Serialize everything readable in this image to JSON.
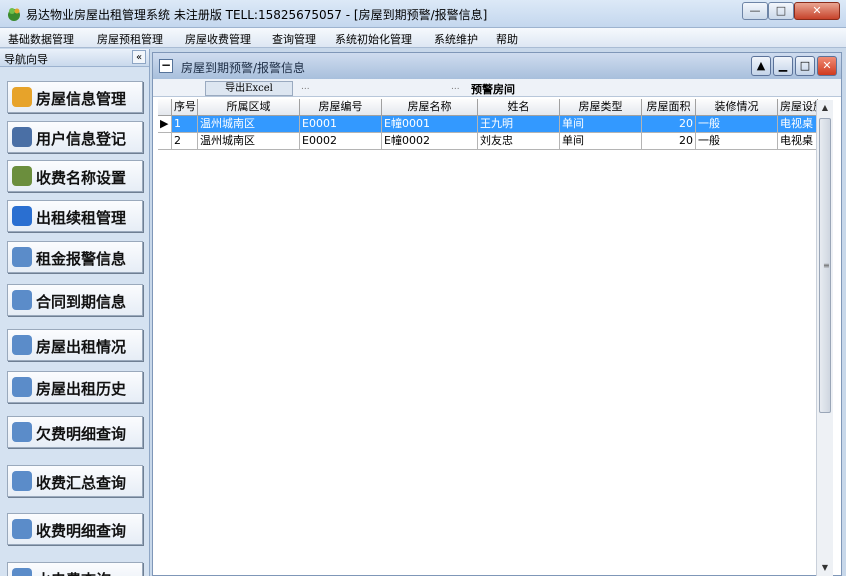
{
  "window": {
    "title": "易达物业房屋出租管理系统 未注册版 TELL:15825675057 - [房屋到期预警/报警信息]",
    "min_label": "—",
    "max_label": "□",
    "close_label": "✕"
  },
  "menu": [
    "基础数据管理",
    "房屋预租管理",
    "房屋收费管理",
    "查询管理",
    "系统初始化管理",
    "系统维护",
    "帮助"
  ],
  "nav": {
    "header": "导航向导",
    "collapse_label": "«",
    "items": [
      {
        "label": "房屋信息管理",
        "icon": "house-icon",
        "color": "#e7a32a"
      },
      {
        "label": "用户信息登记",
        "icon": "user-card-icon",
        "color": "#4a6fa5"
      },
      {
        "label": "收费名称设置",
        "icon": "money-bag-icon",
        "color": "#6b8e3d"
      },
      {
        "label": "出租续租管理",
        "icon": "renew-icon",
        "color": "#2a6fd1"
      },
      {
        "label": "租金报警信息",
        "icon": "magnifier-report-icon",
        "color": "#5b8cc9"
      },
      {
        "label": "合同到期信息",
        "icon": "magnifier-report-icon",
        "color": "#5b8cc9"
      },
      {
        "label": "房屋出租情况",
        "icon": "magnifier-report-icon",
        "color": "#5b8cc9"
      },
      {
        "label": "房屋出租历史",
        "icon": "magnifier-report-icon",
        "color": "#5b8cc9"
      },
      {
        "label": "欠费明细查询",
        "icon": "magnifier-report-icon",
        "color": "#5b8cc9"
      },
      {
        "label": "收费汇总查询",
        "icon": "magnifier-report-icon",
        "color": "#5b8cc9"
      },
      {
        "label": "收费明细查询",
        "icon": "magnifier-report-icon",
        "color": "#5b8cc9"
      },
      {
        "label": "水电费查询",
        "icon": "magnifier-report-icon",
        "color": "#5b8cc9"
      }
    ]
  },
  "panel": {
    "title": "房屋到期预警/报警信息",
    "collapse_label": "−",
    "btn_up": "▲",
    "btn_min": "▁",
    "btn_max": "□",
    "btn_close": "✕"
  },
  "toolbar": {
    "export_label": "导出Excel",
    "dots": "...",
    "caption": "预警房间"
  },
  "grid": {
    "columns": [
      "序号",
      "所属区域",
      "房屋编号",
      "房屋名称",
      "姓名",
      "房屋类型",
      "房屋面积",
      "装修情况",
      "房屋设施"
    ],
    "rows": [
      {
        "no": "1",
        "area": "温州城南区",
        "code": "E0001",
        "name": "E幢0001",
        "person": "王九明",
        "type": "单间",
        "size": "20",
        "decor": "一般",
        "facility": "电视桌"
      },
      {
        "no": "2",
        "area": "温州城南区",
        "code": "E0002",
        "name": "E幢0002",
        "person": "刘友忠",
        "type": "单间",
        "size": "20",
        "decor": "一般",
        "facility": "电视桌"
      }
    ],
    "selected_row": 0,
    "row_pointer": "▶"
  },
  "scrollbar": {
    "up": "▲",
    "down": "▼",
    "grip": "≡"
  },
  "colors": {
    "selection": "#3399ff",
    "accent": "#a8bfdc"
  }
}
